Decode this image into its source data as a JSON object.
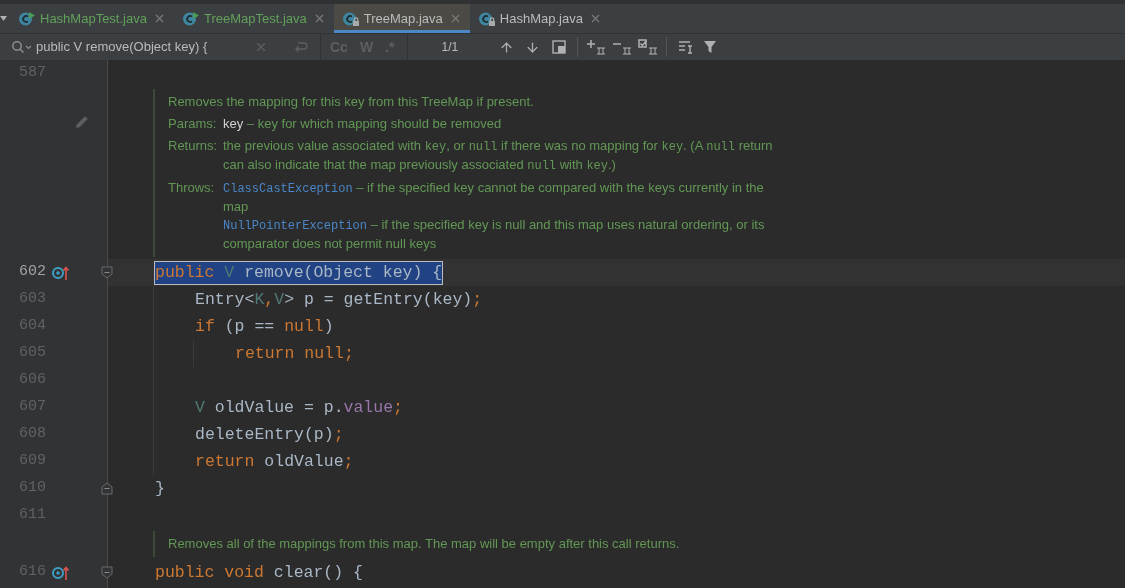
{
  "tabs": [
    {
      "label": "HashMapTest.java",
      "kind": "test",
      "selected": false
    },
    {
      "label": "TreeMapTest.java",
      "kind": "test",
      "selected": false
    },
    {
      "label": "TreeMap.java",
      "kind": "library",
      "selected": true
    },
    {
      "label": "HashMap.java",
      "kind": "library",
      "selected": false
    }
  ],
  "find_bar": {
    "value": "public V remove(Object key) {",
    "options": [
      {
        "label": "Cc",
        "on": false
      },
      {
        "label": "W",
        "on": false
      },
      {
        "label": ".*",
        "on": false
      }
    ],
    "match_count": "1/1"
  },
  "editor": {
    "lines": [
      {
        "kind": "code",
        "number": "587",
        "current": false
      },
      {
        "kind": "doc",
        "edit_icon": true,
        "summary": "Removes the mapping for this key from this TreeMap if present.",
        "sections": [
          {
            "label": "Params:",
            "items": [
              [
                {
                  "kind": "param",
                  "text": "key"
                },
                {
                  "kind": "text",
                  "text": " – key for which mapping should be removed"
                }
              ]
            ]
          },
          {
            "label": "Returns:",
            "items": [
              [
                {
                  "kind": "text",
                  "text": "the previous value associated with "
                },
                {
                  "kind": "code",
                  "text": "key"
                },
                {
                  "kind": "text",
                  "text": ", or "
                },
                {
                  "kind": "code",
                  "text": "null"
                },
                {
                  "kind": "text",
                  "text": " if there was no mapping for "
                },
                {
                  "kind": "code",
                  "text": "key"
                },
                {
                  "kind": "text",
                  "text": ". (A "
                },
                {
                  "kind": "code",
                  "text": "null"
                },
                {
                  "kind": "text",
                  "text": " return can also indicate that the map previously associated "
                },
                {
                  "kind": "code",
                  "text": "null"
                },
                {
                  "kind": "text",
                  "text": " with "
                },
                {
                  "kind": "code",
                  "text": "key"
                },
                {
                  "kind": "text",
                  "text": ".)"
                }
              ]
            ]
          },
          {
            "label": "Throws:",
            "items": [
              [
                {
                  "kind": "link",
                  "text": "ClassCastException"
                },
                {
                  "kind": "text",
                  "text": " – if the specified key cannot be compared with the keys currently in the map"
                }
              ],
              [
                {
                  "kind": "link",
                  "text": "NullPointerException"
                },
                {
                  "kind": "text",
                  "text": " – if the specified key is null and this map uses natural ordering, or its comparator does not permit null keys"
                }
              ]
            ]
          }
        ]
      },
      {
        "kind": "code",
        "number": "602",
        "current": true,
        "override": true,
        "fold": {
          "kind": "start"
        },
        "match": true,
        "tokens": [
          {
            "kind": "keyword",
            "text": "public"
          },
          {
            "kind": "type_param",
            "text": " V"
          },
          {
            "kind": "plain",
            "text": " remove(Object key) {"
          }
        ],
        "children": [
          {
            "kind": "code",
            "number": "603",
            "current": false,
            "match": false,
            "tokens": [
              {
                "kind": "plain",
                "text": "Entry<"
              },
              {
                "kind": "type_param",
                "text": "K"
              },
              {
                "kind": "keyword",
                "text": ","
              },
              {
                "kind": "type_param",
                "text": "V"
              },
              {
                "kind": "plain",
                "text": "> p = getEntry(key)"
              },
              {
                "kind": "keyword",
                "text": ";"
              }
            ]
          },
          {
            "kind": "code",
            "number": "604",
            "current": false,
            "match": false,
            "tokens": [
              {
                "kind": "keyword",
                "text": "if"
              },
              {
                "kind": "plain",
                "text": " (p == "
              },
              {
                "kind": "keyword",
                "text": "null"
              },
              {
                "kind": "plain",
                "text": ")"
              }
            ],
            "children": [
              {
                "kind": "code",
                "number": "605",
                "current": false,
                "match": false,
                "tokens": [
                  {
                    "kind": "keyword",
                    "text": "return null;"
                  }
                ]
              }
            ]
          },
          {
            "kind": "code",
            "number": "606",
            "current": false
          },
          {
            "kind": "code",
            "number": "607",
            "current": false,
            "match": false,
            "tokens": [
              {
                "kind": "type_param",
                "text": "V"
              },
              {
                "kind": "plain",
                "text": " oldValue = p."
              },
              {
                "kind": "field",
                "text": "value"
              },
              {
                "kind": "keyword",
                "text": ";"
              }
            ]
          },
          {
            "kind": "code",
            "number": "608",
            "current": false,
            "match": false,
            "tokens": [
              {
                "kind": "plain",
                "text": "deleteEntry(p)"
              },
              {
                "kind": "keyword",
                "text": ";"
              }
            ]
          },
          {
            "kind": "code",
            "number": "609",
            "current": false,
            "match": false,
            "tokens": [
              {
                "kind": "keyword",
                "text": "return"
              },
              {
                "kind": "plain",
                "text": " oldValue"
              },
              {
                "kind": "keyword",
                "text": ";"
              }
            ]
          }
        ]
      },
      {
        "kind": "code",
        "number": "610",
        "current": false,
        "fold": {
          "kind": "end"
        },
        "match": false,
        "tokens": [
          {
            "kind": "plain",
            "text": "}"
          }
        ]
      },
      {
        "kind": "code",
        "number": "611",
        "current": false
      },
      {
        "kind": "doc",
        "summary": "Removes all of the mappings from this map. The map will be empty after this call returns."
      },
      {
        "kind": "code",
        "number": "616",
        "current": false,
        "override": true,
        "fold": {
          "kind": "start"
        },
        "match": false,
        "tokens": [
          {
            "kind": "keyword",
            "text": "public void"
          },
          {
            "kind": "plain",
            "text": " clear() {"
          }
        ]
      }
    ]
  }
}
